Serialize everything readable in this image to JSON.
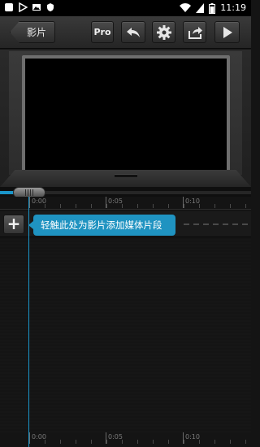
{
  "status_bar": {
    "time": "11:19"
  },
  "toolbar": {
    "back_label": "影片",
    "pro_label": "Pro"
  },
  "timeline": {
    "ruler_labels": [
      "0:00",
      "0:05",
      "0:10"
    ],
    "hint": "轻触此处为影片添加媒体片段"
  },
  "colors": {
    "accent": "#1a95c9",
    "tooltip": "#1f93c1"
  }
}
